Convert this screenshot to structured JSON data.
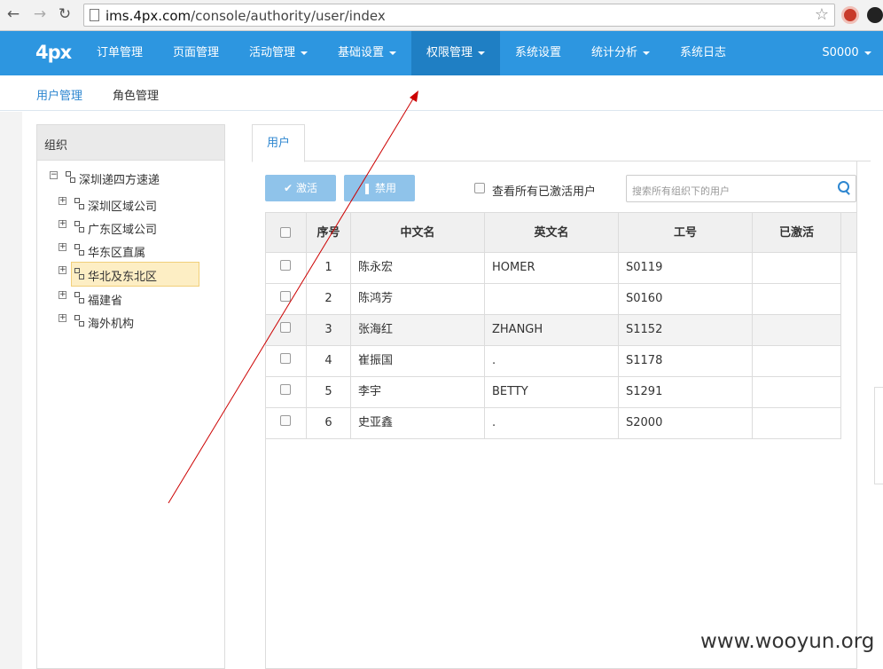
{
  "browser": {
    "url_host": "ims.4px.com",
    "url_path": "/console/authority/user/index"
  },
  "topnav": {
    "logo": "4px",
    "items": [
      {
        "label": "订单管理",
        "has_caret": false,
        "active": false
      },
      {
        "label": "页面管理",
        "has_caret": false,
        "active": false
      },
      {
        "label": "活动管理",
        "has_caret": true,
        "active": false
      },
      {
        "label": "基础设置",
        "has_caret": true,
        "active": false
      },
      {
        "label": "权限管理",
        "has_caret": true,
        "active": true
      },
      {
        "label": "系统设置",
        "has_caret": false,
        "active": false
      },
      {
        "label": "统计分析",
        "has_caret": true,
        "active": false
      },
      {
        "label": "系统日志",
        "has_caret": false,
        "active": false
      }
    ],
    "user": "S0000"
  },
  "subnav": {
    "items": [
      {
        "label": "用户管理",
        "active": true
      },
      {
        "label": "角色管理",
        "active": false
      }
    ]
  },
  "org": {
    "title": "组织",
    "root": "深圳递四方速递",
    "children": [
      "深圳区域公司",
      "广东区域公司",
      "华东区直属",
      "华北及东北区",
      "福建省",
      "海外机构"
    ],
    "selected": "华北及东北区"
  },
  "main": {
    "tab": "用户",
    "activate_label": "激活",
    "disable_label": "禁用",
    "view_all_label": "查看所有已激活用户",
    "search_placeholder": "搜索所有组织下的用户"
  },
  "table": {
    "headers": [
      "序号",
      "中文名",
      "英文名",
      "工号",
      "已激活"
    ],
    "rows": [
      {
        "no": "1",
        "cn": "陈永宏",
        "en": "HOMER",
        "id": "S0119",
        "active": ""
      },
      {
        "no": "2",
        "cn": "陈鸿芳",
        "en": "",
        "id": "S0160",
        "active": ""
      },
      {
        "no": "3",
        "cn": "张海红",
        "en": "ZHANGH",
        "id": "S1152",
        "active": ""
      },
      {
        "no": "4",
        "cn": "崔振国",
        "en": ".",
        "id": "S1178",
        "active": ""
      },
      {
        "no": "5",
        "cn": "李宇",
        "en": "BETTY",
        "id": "S1291",
        "active": ""
      },
      {
        "no": "6",
        "cn": "史亚鑫",
        "en": ".",
        "id": "S2000",
        "active": ""
      }
    ]
  },
  "watermark": "www.wooyun.org",
  "colors": {
    "nav_bg": "#2d96e0",
    "nav_active": "#1f7fc4",
    "button_bg": "#8fc3ea",
    "link": "#2d86d0",
    "annotation_arrow": "#cc0000"
  }
}
